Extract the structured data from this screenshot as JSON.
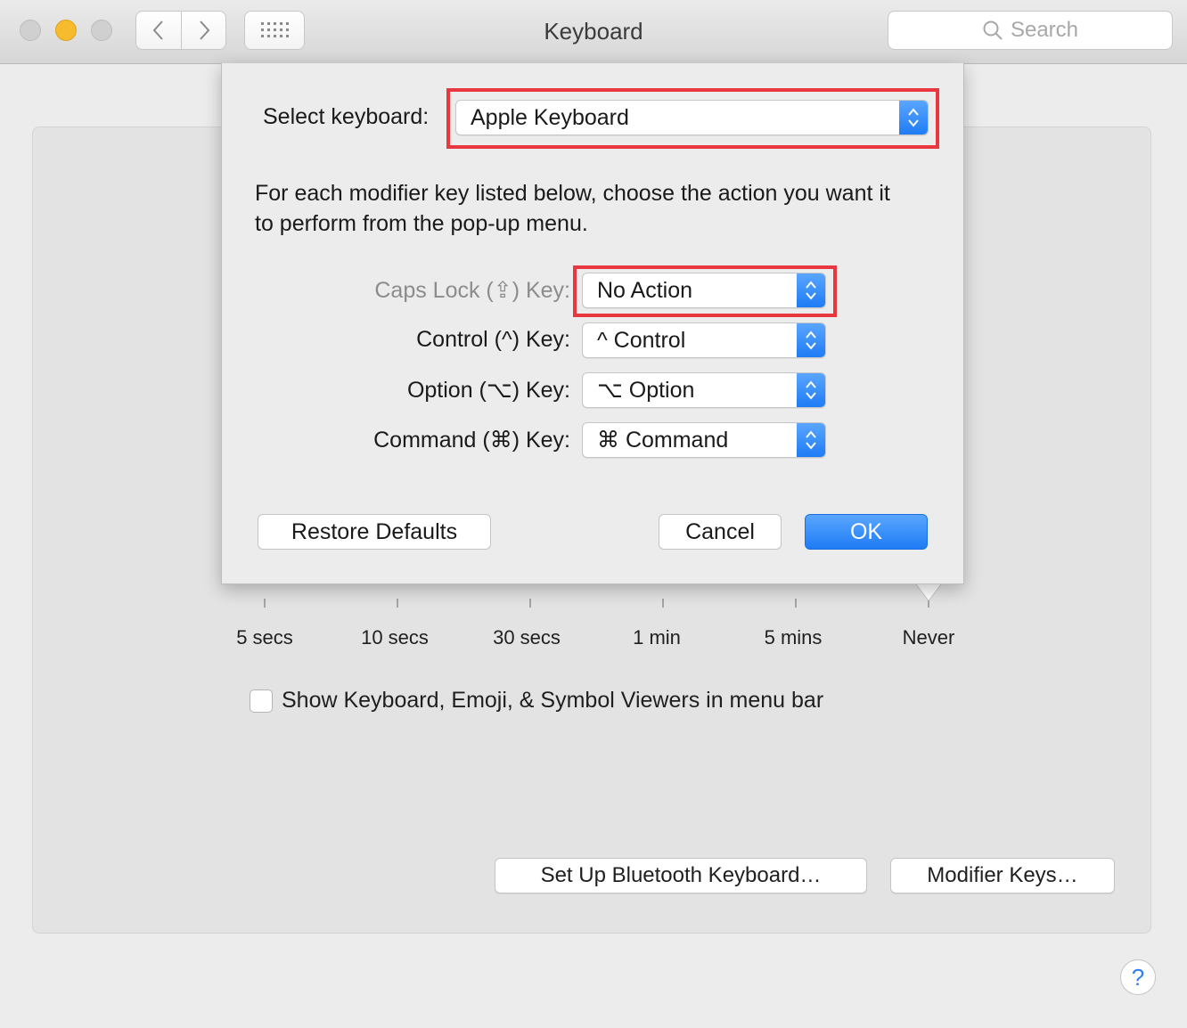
{
  "window": {
    "title": "Keyboard",
    "search_placeholder": "Search"
  },
  "sheet": {
    "select_keyboard_label": "Select keyboard:",
    "select_keyboard_value": "Apple Keyboard",
    "description": "For each modifier key listed below, choose the action you want it to perform from the pop-up menu.",
    "rows": [
      {
        "label": "Caps Lock (⇪) Key:",
        "value": "No Action"
      },
      {
        "label": "Control (^) Key:",
        "value": "^ Control"
      },
      {
        "label": "Option (⌥) Key:",
        "value": "⌥ Option"
      },
      {
        "label": "Command (⌘) Key:",
        "value": "⌘ Command"
      }
    ],
    "restore_defaults": "Restore Defaults",
    "cancel": "Cancel",
    "ok": "OK"
  },
  "panel": {
    "ticks": [
      "5 secs",
      "10 secs",
      "30 secs",
      "1 min",
      "5 mins",
      "Never"
    ],
    "show_viewers_checkbox": {
      "label": "Show Keyboard, Emoji, & Symbol Viewers in menu bar",
      "checked": false
    },
    "bluetooth_button": "Set Up Bluetooth Keyboard…",
    "modifier_keys_button": "Modifier Keys…",
    "help": "?"
  },
  "colors": {
    "accent": "#1f7cf5",
    "highlight": "#e8373f"
  }
}
